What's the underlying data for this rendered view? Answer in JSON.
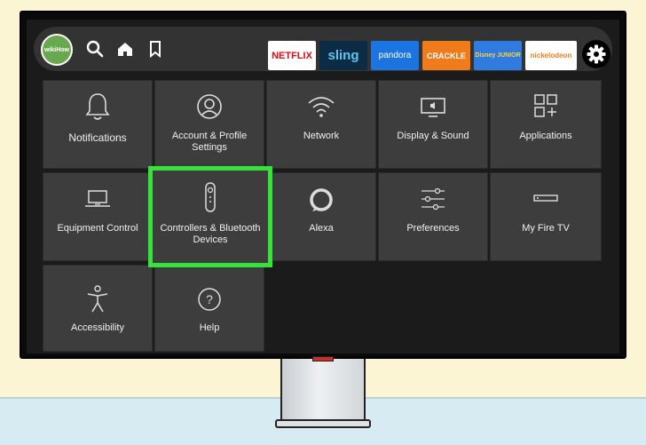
{
  "nav": {
    "avatar_text": "wikiHow",
    "apps": [
      {
        "label": "NETFLIX",
        "bg": "#ffffff",
        "fg": "#e50914"
      },
      {
        "label": "sling",
        "bg": "#0c2b44",
        "fg": "#5fc4f0"
      },
      {
        "label": "pandora",
        "bg": "#1c74e0",
        "fg": "#ffffff"
      },
      {
        "label": "CRACKLE",
        "bg": "#ef7b1a",
        "fg": "#ffffff"
      },
      {
        "label": "Disney JUNIOR",
        "bg": "#2f7be0",
        "fg": "#ffd43b"
      },
      {
        "label": "nickelodeon",
        "bg": "#ffffff",
        "fg": "#f57a16"
      }
    ]
  },
  "tiles": [
    {
      "label": "Notifications",
      "icon": "bell-icon"
    },
    {
      "label": "Account & Profile Settings",
      "icon": "profile-icon"
    },
    {
      "label": "Network",
      "icon": "wifi-icon"
    },
    {
      "label": "Display & Sound",
      "icon": "display-icon"
    },
    {
      "label": "Applications",
      "icon": "apps-icon"
    },
    {
      "label": "Equipment Control",
      "icon": "laptop-icon"
    },
    {
      "label": "Controllers & Bluetooth Devices",
      "icon": "remote-icon"
    },
    {
      "label": "Alexa",
      "icon": "alexa-icon"
    },
    {
      "label": "Preferences",
      "icon": "sliders-icon"
    },
    {
      "label": "My Fire TV",
      "icon": "firetv-icon"
    },
    {
      "label": "Accessibility",
      "icon": "accessibility-icon"
    },
    {
      "label": "Help",
      "icon": "help-icon"
    }
  ],
  "colors": {
    "selection": "#36e33a",
    "tile": "#3d3d3d",
    "nav": "#333333"
  }
}
